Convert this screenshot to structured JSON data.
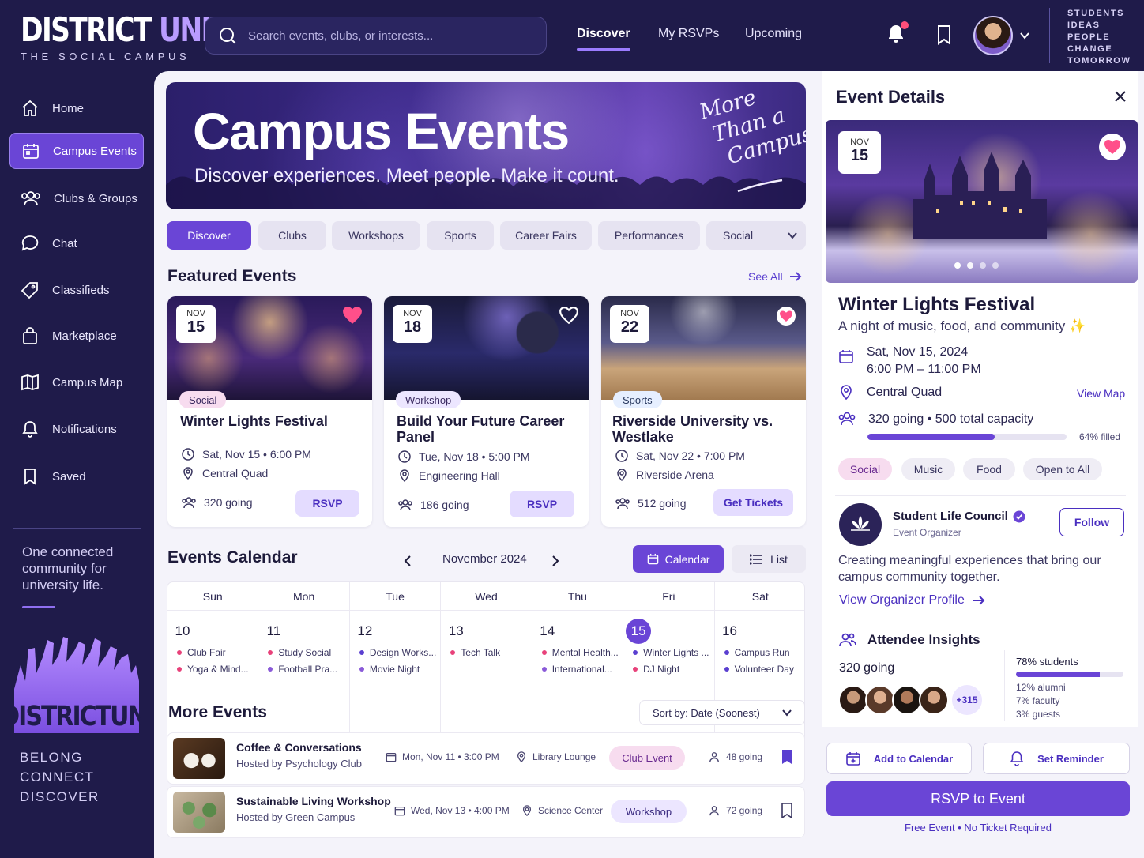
{
  "brand": {
    "name_main": "DISTRICT",
    "name_accent": "UNI",
    "tagline": "THE SOCIAL CAMPUS",
    "side_tag": [
      "STUDENTS",
      "IDEAS",
      "PEOPLE",
      "CHANGE",
      "TOMORROW"
    ],
    "crowd_logo": "DISTRICTUNI"
  },
  "search": {
    "placeholder": "Search events, clubs, or interests..."
  },
  "topnav": [
    "Discover",
    "My RSVPs",
    "Upcoming"
  ],
  "sidebar": {
    "items": [
      {
        "label": "Home",
        "icon": "home-icon"
      },
      {
        "label": "Campus Events",
        "icon": "calendar-icon"
      },
      {
        "label": "Clubs & Groups",
        "icon": "users-icon"
      },
      {
        "label": "Chat",
        "icon": "chat-icon"
      },
      {
        "label": "Classifieds",
        "icon": "tag-icon"
      },
      {
        "label": "Marketplace",
        "icon": "bag-icon"
      },
      {
        "label": "Campus Map",
        "icon": "map-icon"
      },
      {
        "label": "Notifications",
        "icon": "bell-icon"
      },
      {
        "label": "Saved",
        "icon": "bookmark-icon"
      }
    ],
    "quote": "One connected community for university life.",
    "words": [
      "BELONG",
      "CONNECT",
      "DISCOVER"
    ]
  },
  "hero": {
    "title": "Campus Events",
    "subtitle": "Discover experiences. Meet people. Make it count.",
    "script_lines": [
      "More",
      "Than a",
      "Campus"
    ]
  },
  "chips": [
    "Discover",
    "Clubs",
    "Workshops",
    "Sports",
    "Career Fairs",
    "Performances",
    "Social"
  ],
  "featured": {
    "title": "Featured Events",
    "see_all": "See All",
    "cards": [
      {
        "month": "NOV",
        "day": "15",
        "tag": "Social",
        "title": "Winter Lights Festival",
        "datetime": "Sat, Nov 15 • 6:00 PM",
        "location": "Central Quad",
        "going": "320 going",
        "button": "RSVP"
      },
      {
        "month": "NOV",
        "day": "18",
        "tag": "Workshop",
        "title": "Build Your Future Career Panel",
        "datetime": "Tue, Nov 18 • 5:00 PM",
        "location": "Engineering Hall",
        "going": "186 going",
        "button": "RSVP"
      },
      {
        "month": "NOV",
        "day": "22",
        "tag": "Sports",
        "title": "Riverside University vs. Westlake",
        "datetime": "Sat, Nov 22 • 7:00 PM",
        "location": "Riverside Arena",
        "going": "512 going",
        "button": "Get Tickets"
      }
    ]
  },
  "calendar": {
    "title": "Events Calendar",
    "month": "November 2024",
    "calendar_btn": "Calendar",
    "list_btn": "List",
    "days": [
      {
        "name": "Sun",
        "num": "10",
        "events": [
          {
            "t": "Club Fair",
            "c": "#e8417a"
          },
          {
            "t": "Yoga & Mind...",
            "c": "#e8417a"
          }
        ]
      },
      {
        "name": "Mon",
        "num": "11",
        "events": [
          {
            "t": "Study Social",
            "c": "#e8417a"
          },
          {
            "t": "Football Pra...",
            "c": "#8a5ad8"
          }
        ]
      },
      {
        "name": "Tue",
        "num": "12",
        "events": [
          {
            "t": "Design Works...",
            "c": "#5a3fd0"
          },
          {
            "t": "Movie Night",
            "c": "#8a5ad8"
          }
        ]
      },
      {
        "name": "Wed",
        "num": "13",
        "events": [
          {
            "t": "Tech Talk",
            "c": "#e8417a"
          }
        ]
      },
      {
        "name": "Thu",
        "num": "14",
        "events": [
          {
            "t": "Mental Health...",
            "c": "#e8417a"
          },
          {
            "t": "International...",
            "c": "#8a5ad8"
          }
        ]
      },
      {
        "name": "Fri",
        "num": "15",
        "events": [
          {
            "t": "Winter Lights ...",
            "c": "#5a3fd0"
          },
          {
            "t": "DJ Night",
            "c": "#e8417a"
          }
        ]
      },
      {
        "name": "Sat",
        "num": "16",
        "events": [
          {
            "t": "Campus Run",
            "c": "#5a3fd0"
          },
          {
            "t": "Volunteer Day",
            "c": "#5a3fd0"
          }
        ]
      }
    ]
  },
  "more": {
    "title": "More Events",
    "sort": "Sort by: Date (Soonest)",
    "rows": [
      {
        "title": "Coffee & Conversations",
        "host": "Hosted by Psychology Club",
        "datetime": "Mon, Nov 11 • 3:00 PM",
        "location": "Library Lounge",
        "tag": "Club Event",
        "going": "48 going",
        "saved": true
      },
      {
        "title": "Sustainable Living Workshop",
        "host": "Hosted by Green Campus",
        "datetime": "Wed, Nov 13 • 4:00 PM",
        "location": "Science Center",
        "tag": "Workshop",
        "going": "72 going",
        "saved": false
      }
    ]
  },
  "details": {
    "header": "Event Details",
    "month": "NOV",
    "day": "15",
    "title": "Winter Lights Festival",
    "subtitle": "A night of music, food, and community ✨",
    "date": "Sat, Nov 15, 2024",
    "time": "6:00 PM – 11:00 PM",
    "location": "Central Quad",
    "view_map": "View Map",
    "capacity": "320 going • 500 total capacity",
    "fill_pct": 64,
    "fill_label": "64% filled",
    "tags": [
      "Social",
      "Music",
      "Food",
      "Open to All"
    ],
    "organizer": {
      "name": "Student Life Council",
      "role": "Event Organizer",
      "follow": "Follow",
      "desc": "Creating meaningful experiences that bring our campus community together.",
      "link": "View Organizer Profile"
    },
    "insights": {
      "title": "Attendee Insights",
      "going": "320 going",
      "more": "+315",
      "students_label": "78% students",
      "students_pct": 78,
      "breakdown": [
        "12% alumni",
        "7% faculty",
        "3% guests"
      ]
    },
    "add_calendar": "Add to Calendar",
    "reminder": "Set Reminder",
    "rsvp": "RSVP to Event",
    "note": "Free Event • No Ticket Required"
  },
  "colors": {
    "sidebar_bg": "#1f1b4a",
    "accent": "#6a45d6",
    "heart": "#ff4f8a"
  }
}
